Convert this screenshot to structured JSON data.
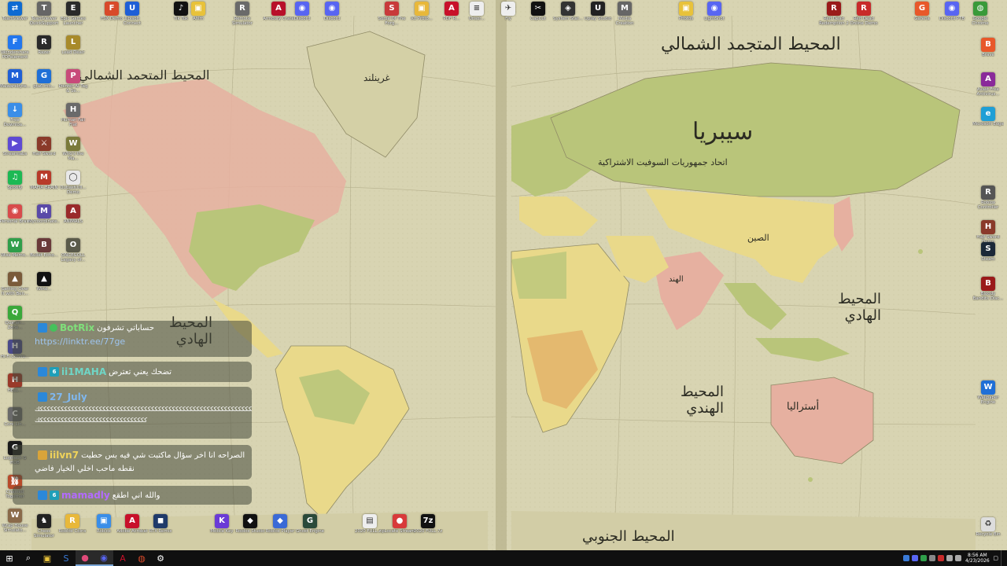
{
  "colors": {
    "ocean": "#d6d2ae",
    "land_green": "#b9c57a",
    "land_yellow": "#e9d98a",
    "land_pink": "#e6b0a0",
    "land_orange": "#e3b36a",
    "chat_link": "#9ec4ef",
    "botrix_green": "#7fe07a",
    "user_green": "#6fd66a",
    "user_blue": "#7fb7ee",
    "user_yellow": "#f0d35a",
    "user_purple": "#b36bff",
    "taskbar": "#101010"
  },
  "map_labels": {
    "atlantic_north": "المحيط المتجمد الشمالي",
    "pacific_north": "المحيط المتحمد الشمالي",
    "asia_siberia": "سيبريا",
    "russia": "اتحاد جمهوريات السوفيت الاشتراكية",
    "pacific_east": "المحيط الهادي",
    "indian_ocean": "المحيط الهندي",
    "south_ocean": "المحيط الجنوبي",
    "atlantic_west": "المحيط الهادي",
    "greenland": "غرينلند",
    "australia": "أستراليا",
    "china": "الصين",
    "india": "الهند"
  },
  "desktop_icons": [
    {
      "name": "teamviewer",
      "label": "TeamViewer",
      "icon": "tv-icon",
      "color": "#0e6ad2",
      "glyph": "⇄",
      "col": 0,
      "row": 0
    },
    {
      "name": "wondershare",
      "label": "Wondershare PDFelement",
      "icon": "pdf-icon",
      "color": "#2277ee",
      "glyph": "F",
      "col": 0,
      "row": 1
    },
    {
      "name": "malwarebytes",
      "label": "Malwarebyte...",
      "icon": "shield-icon",
      "color": "#1f5fd6",
      "glyph": "M",
      "col": 0,
      "row": 2
    },
    {
      "name": "free-downloader",
      "label": "Free Downloa...",
      "icon": "download-icon",
      "color": "#3a8ee8",
      "glyph": "↓",
      "col": 0,
      "row": 3
    },
    {
      "name": "streamlabs",
      "label": "Streamlabs",
      "icon": "streamlabs-icon",
      "color": "#5e4ad4",
      "glyph": "▶",
      "col": 0,
      "row": 4
    },
    {
      "name": "spotify",
      "label": "Spotify",
      "icon": "spotify-icon",
      "color": "#1db954",
      "glyph": "♫",
      "col": 0,
      "row": 5
    },
    {
      "name": "personal-brain",
      "label": "Personal Brain",
      "icon": "brain-icon",
      "color": "#d84b4b",
      "glyph": "◉",
      "col": 0,
      "row": 6
    },
    {
      "name": "wise-memory",
      "label": "Wise Memo...",
      "icon": "memory-icon",
      "color": "#2f9e4a",
      "glyph": "W",
      "col": 0,
      "row": 7
    },
    {
      "name": "getting-over-it",
      "label": "Getting Over It with Ben...",
      "icon": "game-icon",
      "color": "#7a5a3a",
      "glyph": "▲",
      "col": 0,
      "row": 8
    },
    {
      "name": "quarantine-zone",
      "label": "Quaran... Zone...",
      "icon": "game-icon",
      "color": "#3aa83a",
      "glyph": "Q",
      "col": 0,
      "row": 9
    },
    {
      "name": "hi-fi",
      "label": "Hi-Fi Confro...",
      "icon": "game-icon",
      "color": "#4a4a8a",
      "glyph": "H",
      "col": 0,
      "row": 10
    },
    {
      "name": "hell-drive",
      "label": "HELL...",
      "icon": "game-icon",
      "color": "#9a3a2a",
      "glyph": "H",
      "col": 0,
      "row": 11
    },
    {
      "name": "core-lin",
      "label": "Core Lin...",
      "icon": "game-icon",
      "color": "#6a6a6a",
      "glyph": "C",
      "col": 0,
      "row": 12
    },
    {
      "name": "logitech-hub",
      "label": "Logitech G HUB",
      "icon": "logitech-icon",
      "color": "#1a1a1a",
      "glyph": "G",
      "col": 0,
      "row": 13
    },
    {
      "name": "chained-together",
      "label": "Chained Together",
      "icon": "chain-icon",
      "color": "#b84a2a",
      "glyph": "⛓",
      "col": 0,
      "row": 14
    },
    {
      "name": "wrap-house",
      "label": "Wrap House Simulato...",
      "icon": "game-icon",
      "color": "#8a6a4a",
      "glyph": "W",
      "col": 0,
      "row": 15
    },
    {
      "name": "tv-2",
      "label": "TeamViewer QuickSupport",
      "icon": "tv-icon",
      "color": "#666",
      "glyph": "T",
      "col": 1,
      "row": 0
    },
    {
      "name": "razer",
      "label": "Razer",
      "icon": "razer-icon",
      "color": "#2a2a2a",
      "glyph": "R",
      "col": 1,
      "row": 1
    },
    {
      "name": "gta",
      "label": "gta6.mo...",
      "icon": "game-icon",
      "color": "#1f6fd6",
      "glyph": "G",
      "col": 1,
      "row": 2
    },
    {
      "name": "half-sword",
      "label": "Half Sword",
      "icon": "sword-icon",
      "color": "#8a3a2a",
      "glyph": "⚔",
      "col": 1,
      "row": 4
    },
    {
      "name": "mafia",
      "label": "MAFIA BRAIN",
      "icon": "game-icon",
      "color": "#b83a2a",
      "glyph": "M",
      "col": 1,
      "row": 5
    },
    {
      "name": "mycoordinate",
      "label": "Mycoordinate...",
      "icon": "app-icon",
      "color": "#5a4aa8",
      "glyph": "M",
      "col": 1,
      "row": 6
    },
    {
      "name": "bullet-echo",
      "label": "Bullet Echo...",
      "icon": "game-icon",
      "color": "#6a3a3a",
      "glyph": "B",
      "col": 1,
      "row": 7
    },
    {
      "name": "windows-demo",
      "label": "Wind...",
      "icon": "app-icon",
      "color": "#111",
      "glyph": "▲",
      "col": 1,
      "row": 8
    },
    {
      "name": "epic",
      "label": "Epic Games Launcher",
      "icon": "epic-icon",
      "color": "#2a2a2a",
      "glyph": "E",
      "col": 2,
      "row": 0
    },
    {
      "name": "lead",
      "label": "Lead Dealr",
      "icon": "game-icon",
      "color": "#a88a2a",
      "glyph": "L",
      "col": 2,
      "row": 1
    },
    {
      "name": "paladium",
      "label": "Pointer AI Tag & Se...",
      "icon": "app-icon",
      "color": "#c84a7a",
      "glyph": "P",
      "col": 2,
      "row": 2
    },
    {
      "name": "fruits-hill",
      "label": "Human Fall Flat",
      "icon": "game-icon",
      "color": "#6a6a6a",
      "glyph": "H",
      "col": 2,
      "row": 3
    },
    {
      "name": "wheel",
      "label": "Who's the Ma...",
      "icon": "game-icon",
      "color": "#7a7a3a",
      "glyph": "W",
      "col": 2,
      "row": 4
    },
    {
      "name": "outlast",
      "label": "Outlast/Ull... Demo",
      "icon": "game-icon",
      "color": "#e8e8e8",
      "glyph": "◯",
      "col": 2,
      "row": 5
    },
    {
      "name": "animals",
      "label": "ANIMALS",
      "icon": "game-icon",
      "color": "#9a2a2a",
      "glyph": "A",
      "col": 2,
      "row": 6
    },
    {
      "name": "once-legacy",
      "label": "ONCE&OLL Legacy of...",
      "icon": "game-icon",
      "color": "#5a5a4a",
      "glyph": "O",
      "col": 2,
      "row": 7
    }
  ],
  "top_icons": [
    {
      "name": "fsx-demo",
      "label": "FSX Demo",
      "color": "#d84a2a",
      "glyph": "F"
    },
    {
      "name": "ubisoft",
      "label": "Ubisoft Connect",
      "color": "#1f5fd6",
      "glyph": "U"
    },
    {
      "name": "tiktok",
      "label": "Tik Tok",
      "color": "#111",
      "glyph": "♪"
    },
    {
      "name": "folder-a",
      "label": "Ahim",
      "color": "#e8c23a",
      "glyph": "▣"
    },
    {
      "name": "remote-sim",
      "label": "Remote Simulator",
      "color": "#6a6a6a",
      "glyph": "R"
    },
    {
      "name": "asus-armoury",
      "label": "Armoury Crate",
      "color": "#b8102a",
      "glyph": "A"
    },
    {
      "name": "discord-a",
      "label": "Discord",
      "color": "#5865f2",
      "glyph": "◉"
    },
    {
      "name": "discord-b",
      "label": "Discord",
      "color": "#5865f2",
      "glyph": "◉"
    },
    {
      "name": "some-game",
      "label": "Some Of The Forg...",
      "color": "#c83a3a",
      "glyph": "S"
    },
    {
      "name": "vpn-folder",
      "label": "Xo Proto...",
      "color": "#e8b83a",
      "glyph": "▣"
    },
    {
      "name": "pdf-reader",
      "label": "PDF R...",
      "color": "#c8102a",
      "glyph": "A"
    },
    {
      "name": "unsor",
      "label": "Unsor...",
      "color": "#eee",
      "glyph": "≡"
    },
    {
      "name": "fly",
      "label": "Fly",
      "color": "#eee",
      "glyph": "✈"
    },
    {
      "name": "capcut",
      "label": "CapCut",
      "color": "#111",
      "glyph": "✂"
    },
    {
      "name": "system-stat",
      "label": "System Stat...",
      "color": "#333",
      "glyph": "◈"
    },
    {
      "name": "ubisoft-studio",
      "label": "Uplay Studio",
      "color": "#222",
      "glyph": "U"
    },
    {
      "name": "media-creation",
      "label": "Media Creation",
      "color": "#666",
      "glyph": "M"
    },
    {
      "name": "photos-folder",
      "label": "Photos",
      "color": "#e8c23a",
      "glyph": "▣"
    },
    {
      "name": "lightshot",
      "label": "LightShot",
      "color": "#5865f2",
      "glyph": "◉"
    },
    {
      "name": "red-dead",
      "label": "Red Dead Redemption 2",
      "color": "#9a1a1a",
      "glyph": "R"
    },
    {
      "name": "red-card",
      "label": "Red Dead Online Demo",
      "color": "#c82a2a",
      "glyph": "R"
    },
    {
      "name": "garena",
      "label": "Garena",
      "color": "#e8582a",
      "glyph": "G"
    },
    {
      "name": "discord-ptb",
      "label": "Discord PTB",
      "color": "#5865f2",
      "glyph": "◉"
    },
    {
      "name": "google-chrome",
      "label": "Google Chrome",
      "color": "#3a9a3a",
      "glyph": "◍"
    }
  ],
  "right_icons": [
    {
      "name": "brave",
      "label": "Brave",
      "color": "#e8582a",
      "glyph": "B"
    },
    {
      "name": "antivirus",
      "label": "Avast Free Antivirus...",
      "color": "#8a2a9a",
      "glyph": "A"
    },
    {
      "name": "edge",
      "label": "Microsoft Edge",
      "color": "#1f9fd6",
      "glyph": "e"
    },
    {
      "name": "roblox-studio-r",
      "label": "Roblox Controller",
      "color": "#555",
      "glyph": "R"
    },
    {
      "name": "half-sword-r",
      "label": "Half Sword Demo",
      "color": "#8a3a2a",
      "glyph": "H"
    },
    {
      "name": "steam",
      "label": "Steam",
      "color": "#1b2838",
      "glyph": "S"
    },
    {
      "name": "bloody-disc",
      "label": "Bloody Bandits Disc...",
      "color": "#9a1a1a",
      "glyph": "B"
    },
    {
      "name": "wallpaper-engine",
      "label": "Wallpaper Engine",
      "color": "#1f6fd6",
      "glyph": "W"
    },
    {
      "name": "recycle-bin",
      "label": "Recycle Bin",
      "color": "#ddd",
      "glyph": "♻"
    }
  ],
  "bottom_icons": [
    {
      "name": "chess-sim",
      "label": "Chess Simulator",
      "color": "#222",
      "glyph": "♞"
    },
    {
      "name": "roblox-coins",
      "label": "Roblox Coins",
      "color": "#e8b83a",
      "glyph": "R"
    },
    {
      "name": "folder-stuff",
      "label": "Roblox",
      "color": "#3a8ee8",
      "glyph": "▣"
    },
    {
      "name": "acrobat",
      "label": "Adobe Acrobat",
      "color": "#c8102a",
      "glyph": "A"
    },
    {
      "name": "aurora",
      "label": "RTX Remix",
      "color": "#1f3a6a",
      "glyph": "◼"
    },
    {
      "name": "mobile-key",
      "label": "Mobile Key",
      "color": "#6a3ad6",
      "glyph": "K"
    },
    {
      "name": "roblox-studio",
      "label": "Roblox Studio",
      "color": "#111",
      "glyph": "◆"
    },
    {
      "name": "roblox-player",
      "label": "Roblox Player",
      "color": "#3a6ad6",
      "glyph": "◆"
    },
    {
      "name": "ghost-engine",
      "label": "Ghost Engine",
      "color": "#2a4a3a",
      "glyph": "G"
    },
    {
      "name": "zip-file",
      "label": "2020 FULL.zip",
      "color": "#eee",
      "glyph": "▤"
    },
    {
      "name": "locate",
      "label": "Locate Stream",
      "color": "#d83a3a",
      "glyph": "●"
    },
    {
      "name": "7zip",
      "label": "2020 FULL.7z",
      "color": "#111",
      "glyph": "7z"
    }
  ],
  "chat": {
    "messages": [
      {
        "user": "BotRix",
        "user_color": "#7fe07a",
        "text": "حساباتي تشرفون",
        "link": "https://linktr.ee/77ge"
      },
      {
        "user": "ii1MAHA",
        "user_color": "#6fd6c6",
        "text": "تضحك يعني تعترض"
      },
      {
        "user": "27_July",
        "user_color": "#7fb7ee",
        "line1": "ككككككككككككككككككككككككككككككككككككككككككككككككككككككككككككككككككككككك",
        "line2": "كككككككككككككككككككككككككككككككك"
      },
      {
        "user": "iilvn7",
        "user_color": "#f0d35a",
        "text": "الصراحه انا اخر سؤال ماكتبت شي فيه بس حطيت",
        "text2": "نقطه ماحب اخلي الخيار فاضي"
      },
      {
        "user": "mamadly",
        "user_color": "#b36bff",
        "text": "والله اني اطقع"
      }
    ]
  },
  "taskbar": {
    "time": "8:56 AM",
    "date": "4/23/2026",
    "items": [
      {
        "name": "start",
        "color": "#fff",
        "glyph": "⊞"
      },
      {
        "name": "search",
        "color": "#fff",
        "glyph": "⌕"
      },
      {
        "name": "file-explorer",
        "color": "#e8c23a",
        "glyph": "▣"
      },
      {
        "name": "steam",
        "color": "#3a7ad6",
        "glyph": "S"
      },
      {
        "name": "obs",
        "color": "#e04a7a",
        "glyph": "●"
      },
      {
        "name": "discord",
        "color": "#5865f2",
        "glyph": "◉"
      },
      {
        "name": "pdf",
        "color": "#c8102a",
        "glyph": "A"
      },
      {
        "name": "chrome",
        "color": "#d84a2a",
        "glyph": "◍"
      },
      {
        "name": "settings",
        "color": "#fff",
        "glyph": "⚙"
      }
    ]
  }
}
